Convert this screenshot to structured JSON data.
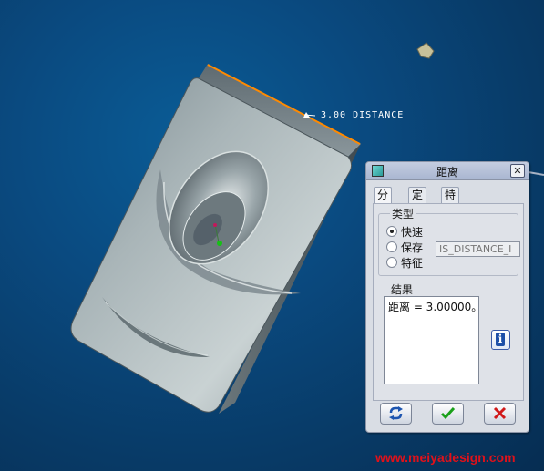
{
  "viewport": {
    "dimension_text": "3.00  DISTANCE",
    "watermark": "www.meiyadesign.com"
  },
  "dialog": {
    "title": "距离",
    "close_glyph": "✕",
    "tabs": [
      {
        "label": "分析",
        "active": true
      },
      {
        "label": "定义",
        "active": false
      },
      {
        "label": "特征",
        "active": false
      }
    ],
    "type_group": {
      "label": "类型",
      "options": [
        {
          "label": "快速",
          "checked": true
        },
        {
          "label": "保存",
          "checked": false
        },
        {
          "label": "特征",
          "checked": false
        }
      ],
      "save_name_value": "IS_DISTANCE_I"
    },
    "result_group": {
      "label": "结果",
      "text": "距离 = 3.00000。"
    },
    "info_glyph": "i",
    "buttons": {
      "repeat_icon": "repeat-icon",
      "ok_icon": "checkmark-icon",
      "cancel_icon": "cross-icon"
    }
  },
  "colors": {
    "background": "#0a4a80",
    "dimension_highlight": "#ff8a00",
    "watermark": "#e0111a",
    "ok_green": "#1aa01a",
    "cancel_red": "#d11a1a"
  }
}
